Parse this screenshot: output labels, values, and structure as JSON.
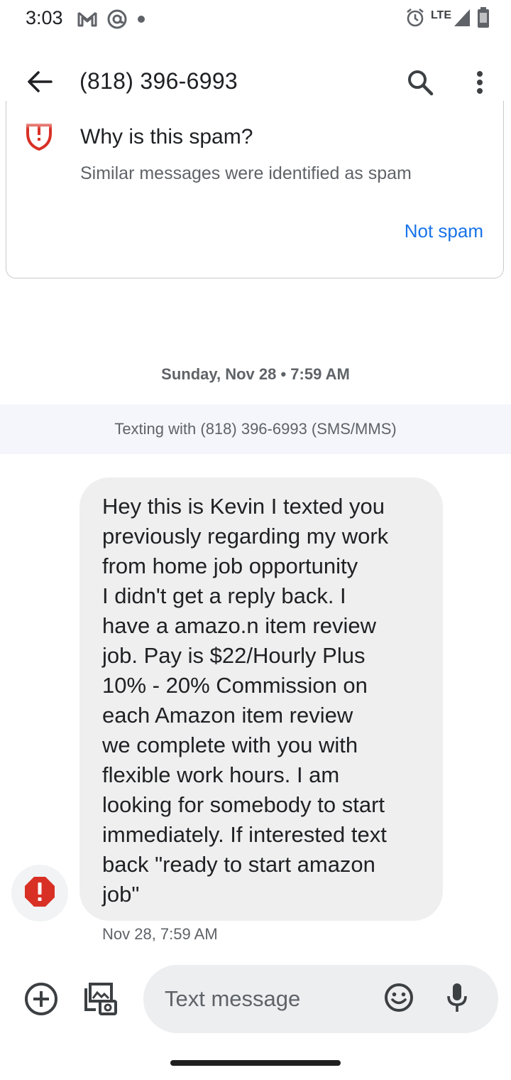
{
  "status_bar": {
    "time": "3:03",
    "network_label": "LTE",
    "icons": [
      "gmail-icon",
      "at-sign-icon",
      "notification-dot-icon",
      "alarm-icon",
      "lte-signal-icon",
      "battery-icon"
    ]
  },
  "app_bar": {
    "title": "(818) 396-6993",
    "icons": [
      "back-arrow-icon",
      "search-icon",
      "more-vert-icon"
    ]
  },
  "spam_card": {
    "title": "Why is this spam?",
    "subtitle": "Similar messages were identified as spam",
    "action_label": "Not spam",
    "icon": "spam-shield-icon",
    "accent_color": "#d93025",
    "action_color": "#1a73e8"
  },
  "conversation": {
    "date_divider": "Sunday, Nov 28 • 7:59 AM",
    "texting_with": "Texting with (818) 396-6993 (SMS/MMS)",
    "messages": [
      {
        "text": "Hey this is Kevin I texted you\npreviously regarding my work\nfrom home job opportunity\nI didn't get a reply back. I\nhave a amazo.n item review\njob. Pay is $22/Hourly Plus\n10% - 20% Commission on\neach Amazon item review\nwe complete with you with\nflexible work hours. I am\nlooking for somebody to start\nimmediately. If interested text\nback \"ready to start amazon\njob\"",
        "timestamp": "Nov 28, 7:59 AM",
        "status_icon": "error-icon"
      }
    ]
  },
  "compose": {
    "placeholder": "Text message",
    "icons": [
      "add-circle-icon",
      "gallery-camera-icon",
      "emoji-icon",
      "mic-icon"
    ]
  }
}
